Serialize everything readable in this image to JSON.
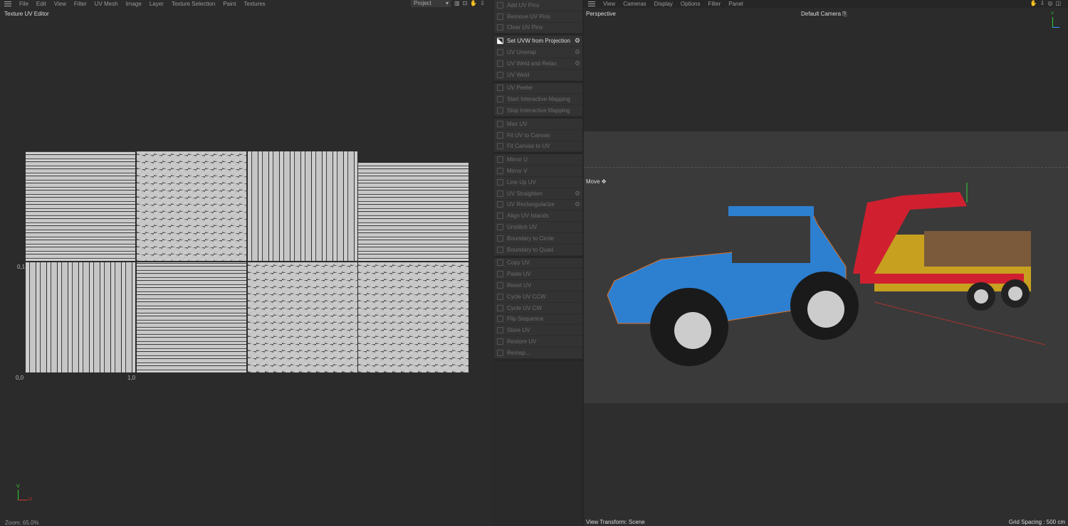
{
  "uv_editor": {
    "menu": [
      "File",
      "Edit",
      "View",
      "Filter",
      "UV Mesh",
      "Image",
      "Layer",
      "Texture Selection",
      "Paint",
      "Textures"
    ],
    "project_select": "Project",
    "title": "Texture UV Editor",
    "axis_labels": {
      "origin": "0,0",
      "u1": "1,0",
      "v1": "0,1"
    },
    "axis_gizmo": {
      "u": "U",
      "v": "V"
    },
    "zoom": "Zoom: 65.0%"
  },
  "commands": [
    [
      {
        "label": "Add UV Pins",
        "icon": "pin-icon"
      },
      {
        "label": "Remove UV Pins",
        "icon": "pin-remove-icon"
      },
      {
        "label": "Clear UV Pins",
        "icon": "close-icon"
      }
    ],
    [
      {
        "label": "Set UVW from Projection",
        "icon": "projection-icon",
        "active": true,
        "gear": true
      },
      {
        "label": "UV Unwrap",
        "icon": "unwrap-icon",
        "gear": true
      },
      {
        "label": "UV Weld and Relax",
        "icon": "weld-relax-icon",
        "gear": true
      },
      {
        "label": "UV Weld",
        "icon": "weld-icon"
      }
    ],
    [
      {
        "label": "UV Peeler",
        "icon": "peeler-icon"
      },
      {
        "label": "Start Interactive Mapping",
        "icon": "play-icon"
      },
      {
        "label": "Stop Interactive Mapping",
        "icon": "stop-icon"
      }
    ],
    [
      {
        "label": "Max UV",
        "icon": "max-icon"
      },
      {
        "label": "Fit UV to Canvas",
        "icon": "fit-icon"
      },
      {
        "label": "Fit Canvas to UV",
        "icon": "fit-canvas-icon"
      }
    ],
    [
      {
        "label": "Mirror U",
        "icon": "mirror-u-icon"
      },
      {
        "label": "Mirror V",
        "icon": "mirror-v-icon"
      },
      {
        "label": "Line Up UV",
        "icon": "line-up-icon"
      },
      {
        "label": "UV Straighten",
        "icon": "straighten-icon",
        "gear": true
      },
      {
        "label": "UV Rectangularize",
        "icon": "rectangularize-icon",
        "gear": true
      },
      {
        "label": "Align UV Islands",
        "icon": "align-icon"
      },
      {
        "label": "Unstitch UV",
        "icon": "unstitch-icon"
      },
      {
        "label": "Boundary to Circle",
        "icon": "circle-icon"
      },
      {
        "label": "Boundary to Quad",
        "icon": "quad-icon"
      }
    ],
    [
      {
        "label": "Copy UV",
        "icon": "copy-icon"
      },
      {
        "label": "Paste UV",
        "icon": "paste-icon"
      },
      {
        "label": "Reset UV",
        "icon": "reset-icon"
      },
      {
        "label": "Cycle UV CCW",
        "icon": "ccw-icon"
      },
      {
        "label": "Cycle UV CW",
        "icon": "cw-icon"
      },
      {
        "label": "Flip Sequence",
        "icon": "flip-icon"
      },
      {
        "label": "Store UV",
        "icon": "store-icon"
      },
      {
        "label": "Restore UV",
        "icon": "restore-icon"
      },
      {
        "label": "Remap...",
        "icon": "remap-icon"
      }
    ]
  ],
  "viewport": {
    "menu": [
      "View",
      "Cameras",
      "Display",
      "Options",
      "Filter",
      "Panel"
    ],
    "view_name": "Perspective",
    "camera": "Default Camera",
    "tool": "Move",
    "view_transform": "View Transform: Scene",
    "grid_spacing": "Grid Spacing : 500 cm",
    "axis_y": "Y"
  }
}
